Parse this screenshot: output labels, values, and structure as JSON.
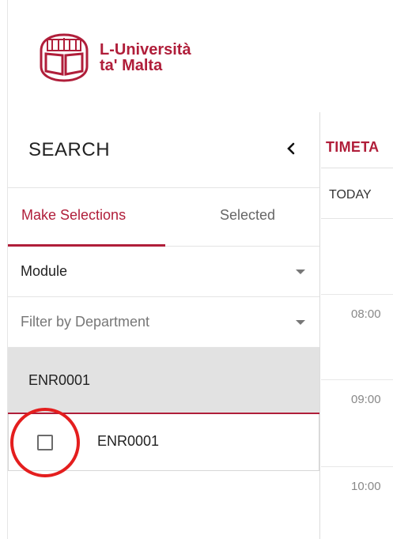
{
  "brand": {
    "name_line1": "L-Università",
    "name_line2": "ta' Malta",
    "color": "#b01e3a"
  },
  "sidebar": {
    "title": "SEARCH",
    "collapse_icon": "chevron-left-icon",
    "tabs": [
      {
        "label": "Make Selections",
        "active": true
      },
      {
        "label": "Selected",
        "active": false
      }
    ],
    "type_select": {
      "value": "Module"
    },
    "department_filter": {
      "placeholder": "Filter by Department"
    },
    "group": {
      "header": "ENR0001",
      "options": [
        {
          "label": "ENR0001",
          "checked": false
        }
      ]
    }
  },
  "timetable": {
    "title": "TIMETA",
    "today_label": "TODAY",
    "hours": [
      "08:00",
      "09:00",
      "10:00"
    ]
  },
  "annotation": {
    "color": "#e41e1e"
  }
}
